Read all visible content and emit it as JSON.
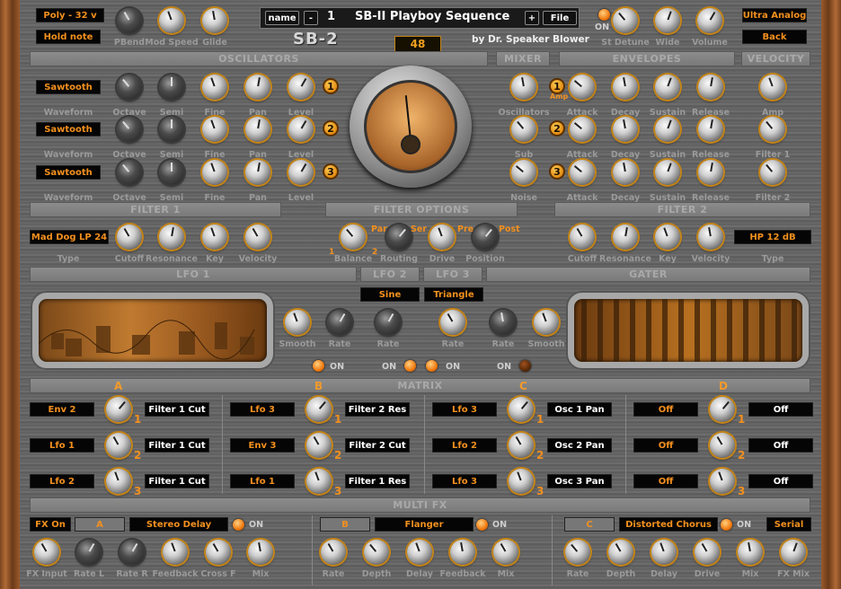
{
  "header": {
    "poly": "Poly - 32 v",
    "hold": "Hold note",
    "name_btn": "name",
    "prev": "-",
    "patch_num": "1",
    "patch_name": "SB-II Playboy Sequence",
    "next": "+",
    "file": "File",
    "logo": "SB-2",
    "bpm": "48",
    "byline": "by Dr. Speaker Blower",
    "on": "ON",
    "ultra": "Ultra Analog",
    "back": "Back"
  },
  "top_knobs": {
    "pbend": "PBend",
    "modspeed": "Mod Speed",
    "glide": "Glide",
    "detune": "St Detune",
    "wide": "Wide",
    "volume": "Volume"
  },
  "sections": {
    "osc": "OSCILLATORS",
    "mixer": "MIXER",
    "env": "ENVELOPES",
    "vel": "VELOCITY",
    "filter1": "FILTER 1",
    "filteropt": "FILTER OPTIONS",
    "filter2": "FILTER 2",
    "lfo1": "LFO 1",
    "lfo2": "LFO 2",
    "lfo3": "LFO 3",
    "gater": "GATER",
    "matrix": "MATRIX",
    "multifx": "MULTI FX"
  },
  "osc": {
    "waves": [
      "Sawtooth",
      "Sawtooth",
      "Sawtooth"
    ],
    "labels": [
      "Waveform",
      "Octave",
      "Semi",
      "Fine",
      "Pan",
      "Level"
    ],
    "nums": [
      "1",
      "2",
      "3"
    ]
  },
  "mixer": {
    "labels": [
      "Oscillators",
      "Sub",
      "Noise"
    ]
  },
  "env": {
    "labels": [
      "Attack",
      "Decay",
      "Sustain",
      "Release"
    ],
    "amp": "Amp"
  },
  "vel": {
    "labels": [
      "Amp",
      "Filter 1",
      "Filter 2"
    ]
  },
  "filter1": {
    "type": "Mad Dog LP 24",
    "labels": [
      "Type",
      "Cutoff",
      "Resonance",
      "Key",
      "Velocity"
    ]
  },
  "filteropt": {
    "par": "Par",
    "ser": "Ser",
    "pre": "Pre",
    "post": "Post",
    "one": "1",
    "two": "2",
    "labels": [
      "Balance",
      "Routing",
      "Drive",
      "Position"
    ]
  },
  "filter2": {
    "type": "HP 12 dB",
    "labels": [
      "Cutoff",
      "Resonance",
      "Key",
      "Velocity",
      "Type"
    ]
  },
  "lfo": {
    "lfo2_wave": "Sine",
    "lfo3_wave": "Triangle",
    "labels": [
      "Smooth",
      "Rate",
      "Rate",
      "Rate",
      "Rate",
      "Smooth"
    ],
    "on": "ON"
  },
  "matrix": {
    "cols": [
      "A",
      "B",
      "C",
      "D"
    ],
    "rows": [
      [
        {
          "src": "Env 2",
          "dst": "Filter 1 Cut"
        },
        {
          "src": "Lfo 3",
          "dst": "Filter 2 Res"
        },
        {
          "src": "Lfo 3",
          "dst": "Osc 1 Pan"
        },
        {
          "src": "Off",
          "dst": "Off"
        }
      ],
      [
        {
          "src": "Lfo 1",
          "dst": "Filter 1 Cut"
        },
        {
          "src": "Env 3",
          "dst": "Filter 2 Cut"
        },
        {
          "src": "Lfo 2",
          "dst": "Osc 2 Pan"
        },
        {
          "src": "Off",
          "dst": "Off"
        }
      ],
      [
        {
          "src": "Lfo 2",
          "dst": "Filter 1 Cut"
        },
        {
          "src": "Lfo 1",
          "dst": "Filter 1 Res"
        },
        {
          "src": "Lfo 3",
          "dst": "Osc 3 Pan"
        },
        {
          "src": "Off",
          "dst": "Off"
        }
      ]
    ],
    "nums": [
      "1",
      "2",
      "3"
    ]
  },
  "fx": {
    "fxon": "FX On",
    "a": "A",
    "b": "B",
    "c": "C",
    "a_type": "Stereo Delay",
    "b_type": "Flanger",
    "c_type": "Distorted Chorus",
    "serial": "Serial",
    "on": "ON",
    "a_labels": [
      "FX Input",
      "Rate L",
      "Rate R",
      "Feedback",
      "Cross F",
      "Mix"
    ],
    "b_labels": [
      "Rate",
      "Depth",
      "Delay",
      "Feedback",
      "Mix"
    ],
    "c_labels": [
      "Rate",
      "Depth",
      "Delay",
      "Drive",
      "Mix",
      "FX Mix"
    ]
  },
  "colors": {
    "accent": "#f3901e",
    "panel": "#666666",
    "wood": "#9a5a2c"
  }
}
